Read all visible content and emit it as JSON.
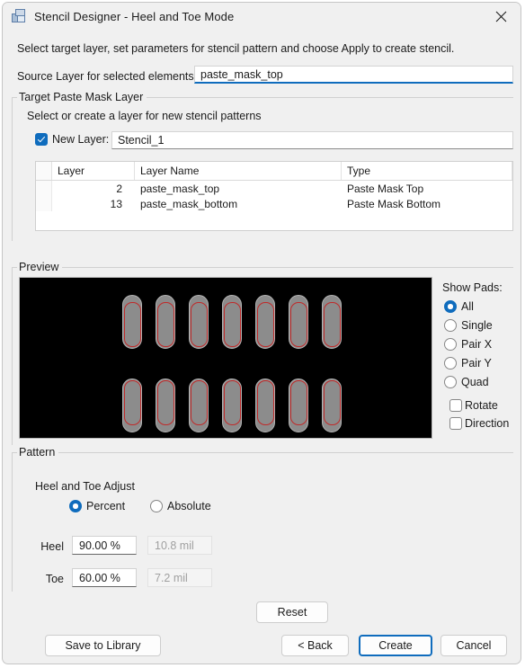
{
  "window": {
    "title": "Stencil Designer - Heel and Toe Mode",
    "icon": "stencil-app-icon",
    "close_label": "×"
  },
  "instruction": "Select target layer, set parameters for stencil pattern and choose Apply to create stencil.",
  "source_layer": {
    "label": "Source Layer for selected elements:",
    "value": "paste_mask_top"
  },
  "target_group": {
    "title": "Target Paste Mask Layer",
    "subtitle": "Select or create a layer for new stencil patterns",
    "new_layer": {
      "label": "New Layer:",
      "checked": true,
      "value": "Stencil_1"
    },
    "table": {
      "columns": [
        "Layer",
        "Layer Name",
        "Type"
      ],
      "rows": [
        {
          "layer": "2",
          "name": "paste_mask_top",
          "type": "Paste Mask Top"
        },
        {
          "layer": "13",
          "name": "paste_mask_bottom",
          "type": "Paste Mask Bottom"
        }
      ]
    }
  },
  "preview_group": {
    "title": "Preview",
    "background": "#000000",
    "pad_color": "#8c8c8c",
    "pad_outline": "#b4b4b4",
    "stencil_color": "#c02a2a",
    "rows": 2,
    "pads_per_row": 7
  },
  "show_pads": {
    "title": "Show Pads:",
    "options": [
      {
        "label": "All",
        "selected": true
      },
      {
        "label": "Single",
        "selected": false
      },
      {
        "label": "Pair X",
        "selected": false
      },
      {
        "label": "Pair Y",
        "selected": false
      },
      {
        "label": "Quad",
        "selected": false
      }
    ],
    "checkboxes": [
      {
        "label": "Rotate",
        "checked": false
      },
      {
        "label": "Direction",
        "checked": false
      }
    ]
  },
  "pattern_group": {
    "title": "Pattern",
    "subtitle": "Heel and Toe Adjust",
    "mode_options": [
      {
        "label": "Percent",
        "selected": true
      },
      {
        "label": "Absolute",
        "selected": false
      }
    ],
    "fields": [
      {
        "label": "Heel",
        "value": "90.00 %",
        "absolute": "10.8 mil"
      },
      {
        "label": "Toe",
        "value": "60.00 %",
        "absolute": "7.2 mil"
      }
    ]
  },
  "buttons": {
    "reset": "Reset",
    "save_to_library": "Save to Library",
    "back": "< Back",
    "create": "Create",
    "cancel": "Cancel"
  },
  "colors": {
    "accent": "#0f6cbd",
    "window_bg": "#f0f0f0",
    "stencil_red": "#c02a2a"
  }
}
